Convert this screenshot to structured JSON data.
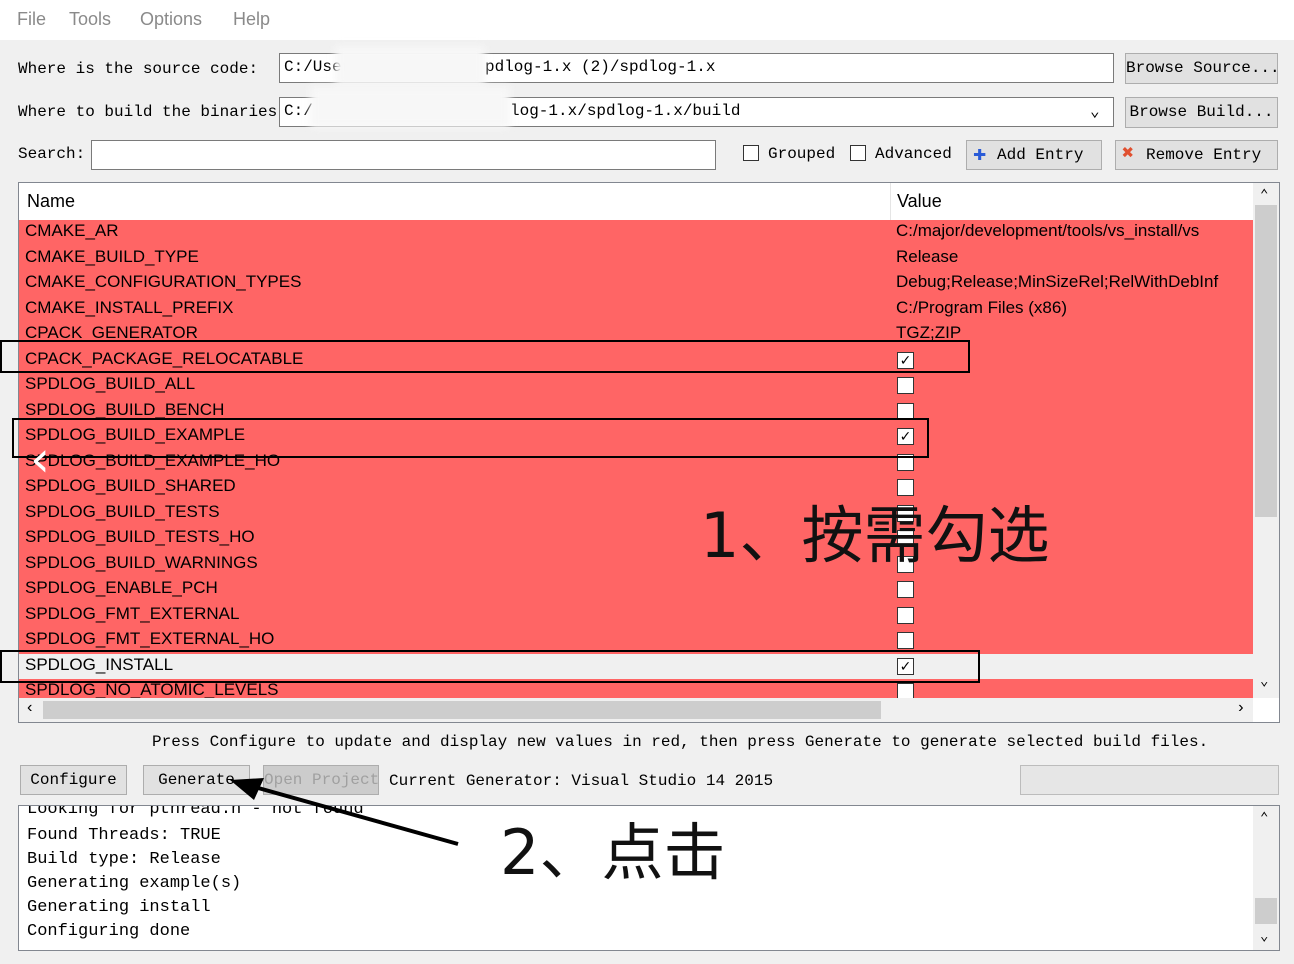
{
  "menu": [
    "File",
    "Tools",
    "Options",
    "Help"
  ],
  "source": {
    "label": "Where is the source code:",
    "value_left": "C:/User",
    "value_right": "pdlog-1.x (2)/spdlog-1.x",
    "browse": "Browse Source..."
  },
  "build": {
    "label": "Where to build the binaries:",
    "value_left": "C:/",
    "value_right": "log-1.x/spdlog-1.x/build",
    "browse": "Browse Build..."
  },
  "search": {
    "label": "Search:",
    "value": "",
    "grouped": "Grouped",
    "advanced": "Advanced",
    "add": "Add Entry",
    "remove": "Remove Entry"
  },
  "table": {
    "col_name": "Name",
    "col_value": "Value",
    "rows": [
      {
        "name": "CMAKE_AR",
        "value": "C:/major/development/tools/vs_install/vs"
      },
      {
        "name": "CMAKE_BUILD_TYPE",
        "value": "Release"
      },
      {
        "name": "CMAKE_CONFIGURATION_TYPES",
        "value": "Debug;Release;MinSizeRel;RelWithDebInf"
      },
      {
        "name": "CMAKE_INSTALL_PREFIX",
        "value": "C:/Program Files (x86)"
      },
      {
        "name": "CPACK_GENERATOR",
        "value": "TGZ;ZIP"
      },
      {
        "name": "CPACK_PACKAGE_RELOCATABLE",
        "check": true
      },
      {
        "name": "SPDLOG_BUILD_ALL",
        "check": false
      },
      {
        "name": "SPDLOG_BUILD_BENCH",
        "check": false
      },
      {
        "name": "SPDLOG_BUILD_EXAMPLE",
        "check": true
      },
      {
        "name": "SPDLOG_BUILD_EXAMPLE_HO",
        "check": false
      },
      {
        "name": "SPDLOG_BUILD_SHARED",
        "check": false
      },
      {
        "name": "SPDLOG_BUILD_TESTS",
        "check": false
      },
      {
        "name": "SPDLOG_BUILD_TESTS_HO",
        "check": false
      },
      {
        "name": "SPDLOG_BUILD_WARNINGS",
        "check": false
      },
      {
        "name": "SPDLOG_ENABLE_PCH",
        "check": false
      },
      {
        "name": "SPDLOG_FMT_EXTERNAL",
        "check": false
      },
      {
        "name": "SPDLOG_FMT_EXTERNAL_HO",
        "check": false
      },
      {
        "name": "SPDLOG_INSTALL",
        "check": true,
        "selected": true
      },
      {
        "name": "SPDLOG_NO_ATOMIC_LEVELS",
        "check": false
      }
    ]
  },
  "hint": "Press Configure to update and display new values in red, then press Generate to generate selected build files.",
  "buttons": {
    "configure": "Configure",
    "generate": "Generate",
    "open_project": "Open Project"
  },
  "generator": "Current Generator: Visual Studio 14 2015",
  "log": [
    "Looking for pthread.h - not found",
    "Found Threads: TRUE",
    "Build type: Release",
    "Generating example(s)",
    "Generating install",
    "Configuring done"
  ],
  "annotations": {
    "step1": "1、按需勾选",
    "step2": "2、点击"
  },
  "colors": {
    "changed_row": "#ff6565",
    "selected_row": "#f0f0f0"
  }
}
